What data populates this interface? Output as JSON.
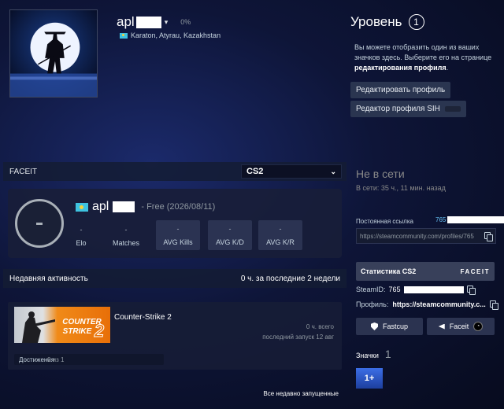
{
  "profile": {
    "persona_name": "apl",
    "xp_percent": "0%",
    "location": "Karaton, Atyrau, Kazakhstan"
  },
  "level": {
    "title": "Уровень",
    "value": "1",
    "badge_hint_text": "Вы можете отобразить один из ваших значков здесь. Выберите его на странице ",
    "badge_hint_link": "редактирования профиля",
    "badge_hint_end": ".",
    "edit_profile_label": "Редактировать профиль",
    "sih_label": "Редактор профиля SIH"
  },
  "faceit": {
    "header": "FACEIT",
    "game_select": "CS2",
    "name": "apl",
    "membership": "- Free (2026/08/11)",
    "stats": [
      {
        "value": "-",
        "label": "Elo"
      },
      {
        "value": "-",
        "label": "Matches"
      },
      {
        "value": "-",
        "label": "AVG Kills"
      },
      {
        "value": "-",
        "label": "AVG K/D"
      },
      {
        "value": "-",
        "label": "AVG K/R"
      }
    ]
  },
  "recent": {
    "title": "Недавняя активность",
    "summary": "0 ч. за последние 2 недели",
    "game": {
      "name": "Counter-Strike 2",
      "capsule_line1": "COUNTER",
      "capsule_line2": "STRIKE",
      "capsule_num": "2",
      "hours": "0 ч. всего",
      "last_launch": "последний запуск 12 авг",
      "achievements_label": "Достижения",
      "achievements_value": "0 из 1"
    },
    "all_recent_label": "Все недавно запущенные"
  },
  "side": {
    "status_title": "Не в сети",
    "status_sub": "В сети: 35 ч., 11 мин. назад",
    "permalink_label": "Постоянная ссылка",
    "permalink_prefix": "765",
    "permalink_url": "https://steamcommunity.com/profiles/765",
    "stats_banner_label": "Статистика CS2",
    "stats_banner_logo": "FACEIT",
    "steamid_label": "SteamID:",
    "steamid_prefix": "765",
    "profile_label": "Профиль:",
    "profile_value": "https://steamcommunity.c...",
    "fastcup_label": "Fastcup",
    "faceit_label": "Faceit",
    "badges_label": "Значки",
    "badges_count": "1",
    "badge_tile": "1+"
  }
}
